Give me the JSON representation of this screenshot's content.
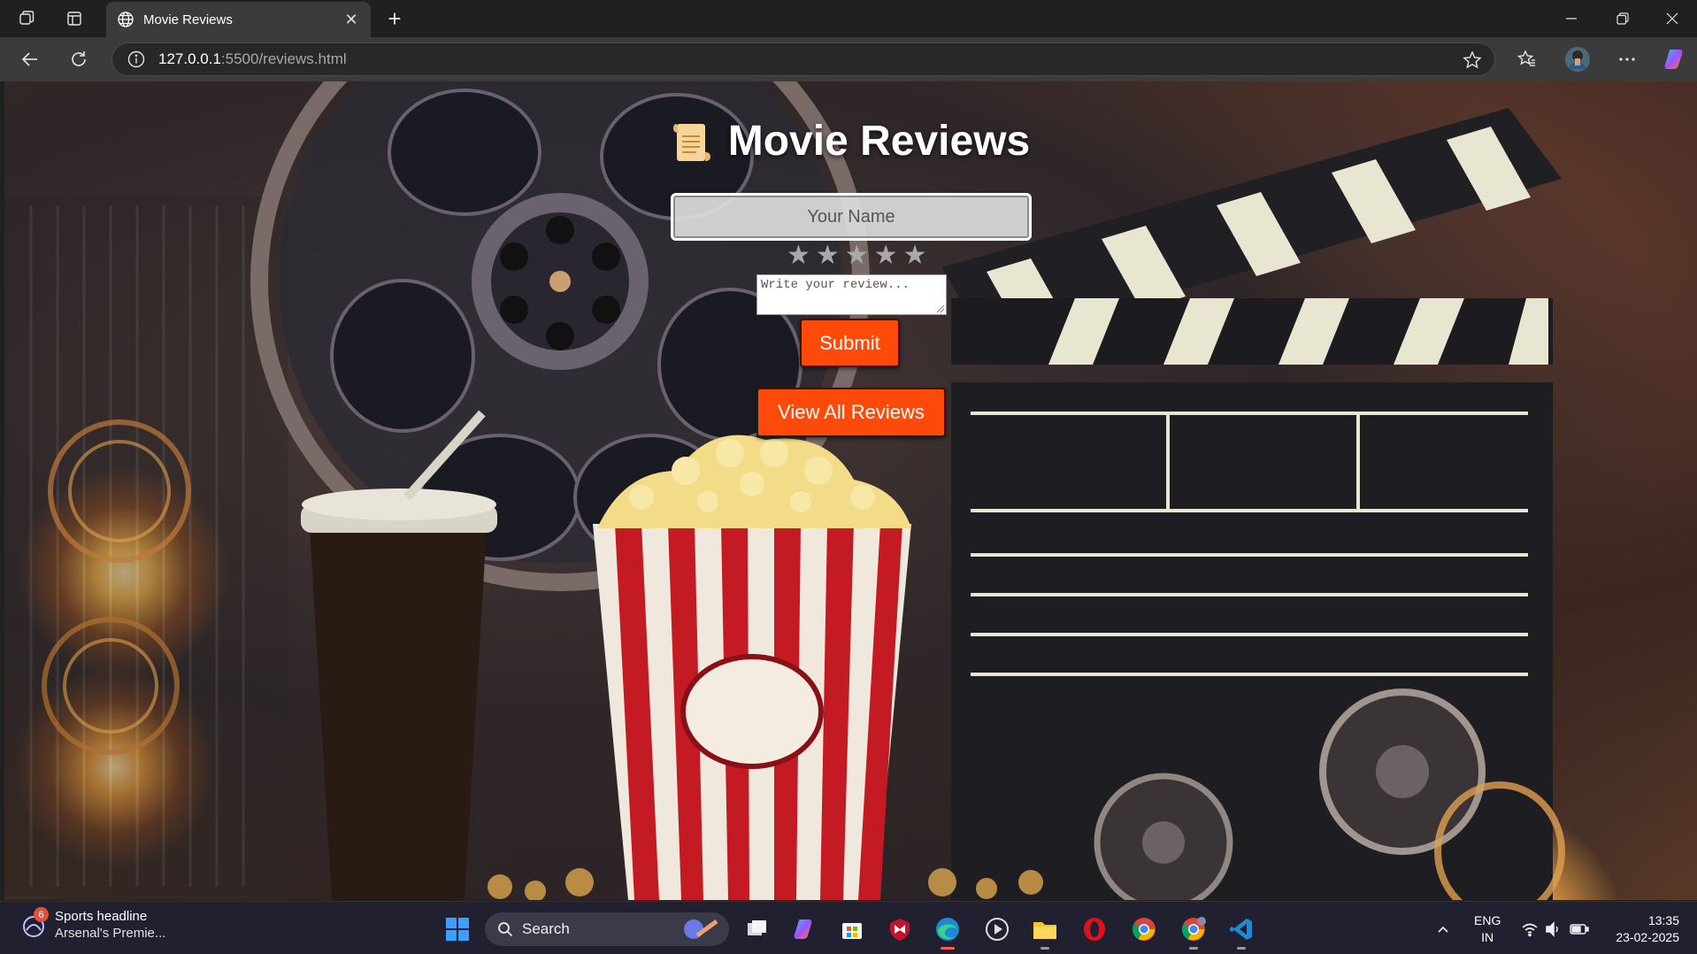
{
  "browser": {
    "tab_title": "Movie Reviews",
    "url_host": "127.0.0.1",
    "url_path": ":5500/reviews.html"
  },
  "page": {
    "title": "Movie Reviews",
    "name_placeholder": "Your Name",
    "star_count_shown": 5,
    "stars": [
      "★",
      "★",
      "★",
      "★",
      "★"
    ],
    "review_placeholder": "Write your review...",
    "submit_label": "Submit",
    "view_all_label": "View All Reviews",
    "accent_color": "#ff4a0a"
  },
  "taskbar": {
    "news_badge": "6",
    "news_title": "Sports headline",
    "news_subtitle": "Arsenal's Premie...",
    "search_label": "Search",
    "lang_line1": "ENG",
    "lang_line2": "IN",
    "time": "13:35",
    "date": "23-02-2025"
  }
}
